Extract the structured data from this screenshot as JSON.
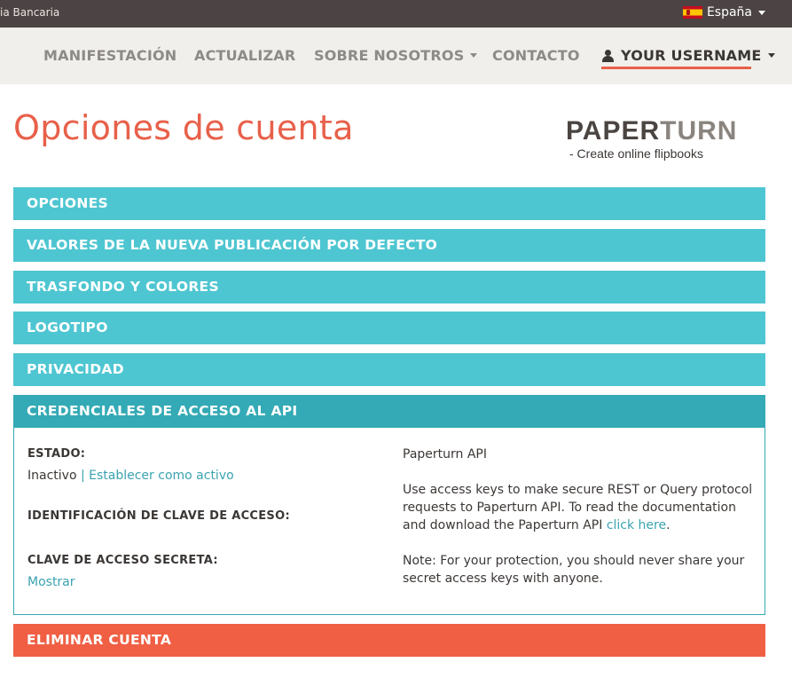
{
  "topbar": {
    "left_text": "ia Bancaria",
    "language": "España"
  },
  "nav": {
    "items": [
      "MANIFESTACIÓN",
      "ACTUALIZAR",
      "SOBRE NOSOTROS",
      "CONTACTO"
    ],
    "user": "YOUR USERNAME"
  },
  "page": {
    "title": "Opciones de cuenta"
  },
  "logo": {
    "word_main": "PAPER",
    "word_accent": "TURN",
    "tagline": "- Create online flipbooks"
  },
  "panels": [
    "OPCIONES",
    "VALORES DE LA NUEVA PUBLICACIÓN POR DEFECTO",
    "TRASFONDO Y COLORES",
    "LOGOTIPO",
    "PRIVACIDAD",
    "CREDENCIALES DE ACCESO AL API",
    "ELIMINAR CUENTA"
  ],
  "api": {
    "status_label": "ESTADO:",
    "status_value": "Inactivo",
    "separator": "|",
    "activate_link": "Establecer como activo",
    "key_id_label": "IDENTIFICACIÓN DE CLAVE DE ACCESO:",
    "secret_label": "CLAVE DE ACCESO SECRETA:",
    "show_link": "Mostrar",
    "right_title": "Paperturn API",
    "desc_prefix": "Use access keys to make secure REST or Query protocol requests to Paperturn API. To read the documentation and download the Paperturn API ",
    "desc_link": "click here",
    "desc_suffix": ".",
    "note": "Note: For your protection, you should never share your secret access keys with anyone."
  },
  "colors": {
    "accent": "#e8604a",
    "panel": "#4ec6d1",
    "panel_active": "#33aab5",
    "danger": "#f05f44",
    "link": "#3aa3b0"
  }
}
